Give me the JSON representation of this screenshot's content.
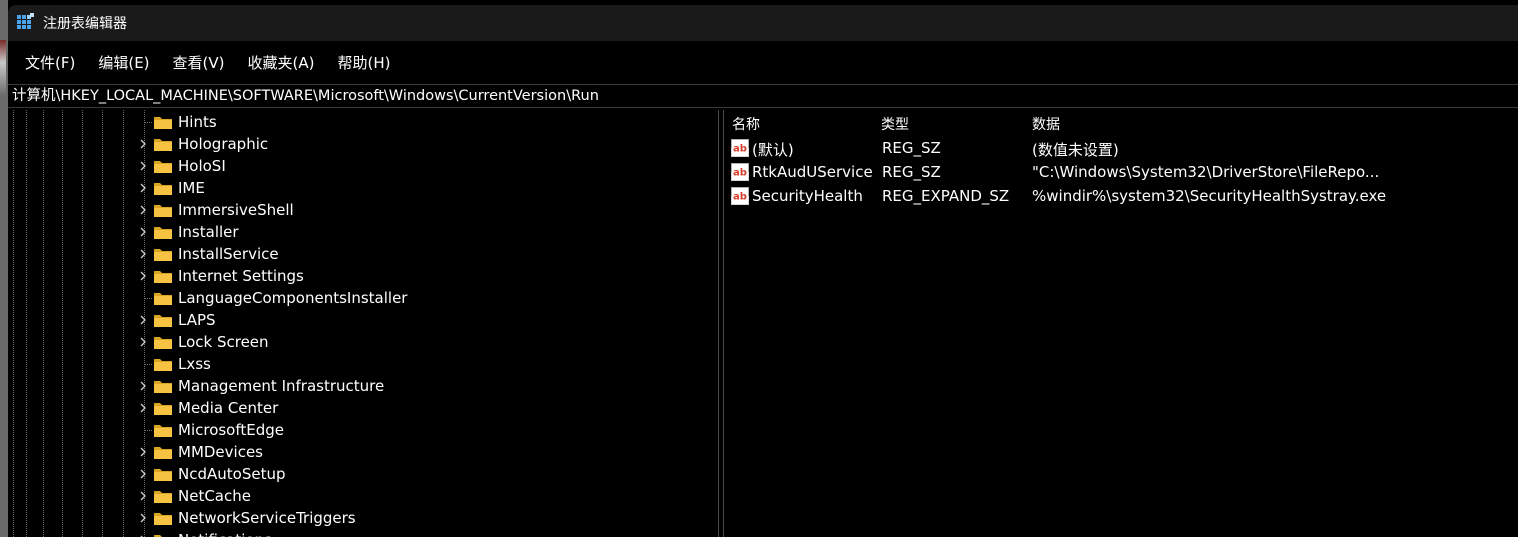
{
  "window": {
    "title": "注册表编辑器",
    "accent_color": "#4aa3e8",
    "folder_color": "#f5c242"
  },
  "menu": [
    {
      "label": "文件(F)"
    },
    {
      "label": "编辑(E)"
    },
    {
      "label": "查看(V)"
    },
    {
      "label": "收藏夹(A)"
    },
    {
      "label": "帮助(H)"
    }
  ],
  "address": {
    "path": "计算机\\HKEY_LOCAL_MACHINE\\SOFTWARE\\Microsoft\\Windows\\CurrentVersion\\Run"
  },
  "tree": {
    "items": [
      {
        "label": "Hints",
        "expandable": false
      },
      {
        "label": "Holographic",
        "expandable": true
      },
      {
        "label": "HoloSI",
        "expandable": true
      },
      {
        "label": "IME",
        "expandable": true
      },
      {
        "label": "ImmersiveShell",
        "expandable": true
      },
      {
        "label": "Installer",
        "expandable": true
      },
      {
        "label": "InstallService",
        "expandable": true
      },
      {
        "label": "Internet Settings",
        "expandable": true
      },
      {
        "label": "LanguageComponentsInstaller",
        "expandable": false
      },
      {
        "label": "LAPS",
        "expandable": true
      },
      {
        "label": "Lock Screen",
        "expandable": true
      },
      {
        "label": "Lxss",
        "expandable": false
      },
      {
        "label": "Management Infrastructure",
        "expandable": true
      },
      {
        "label": "Media Center",
        "expandable": true
      },
      {
        "label": "MicrosoftEdge",
        "expandable": false
      },
      {
        "label": "MMDevices",
        "expandable": true
      },
      {
        "label": "NcdAutoSetup",
        "expandable": true
      },
      {
        "label": "NetCache",
        "expandable": true
      },
      {
        "label": "NetworkServiceTriggers",
        "expandable": true
      },
      {
        "label": "Notifications",
        "expandable": true
      }
    ]
  },
  "values": {
    "headers": {
      "name": "名称",
      "type": "类型",
      "data": "数据"
    },
    "rows": [
      {
        "name": "(默认)",
        "type": "REG_SZ",
        "data": "(数值未设置)",
        "icon": "string-value-icon"
      },
      {
        "name": "RtkAudUService",
        "type": "REG_SZ",
        "data": "\"C:\\Windows\\System32\\DriverStore\\FileRepo...",
        "icon": "string-value-icon"
      },
      {
        "name": "SecurityHealth",
        "type": "REG_EXPAND_SZ",
        "data": "%windir%\\system32\\SecurityHealthSystray.exe",
        "icon": "string-value-icon"
      }
    ]
  }
}
